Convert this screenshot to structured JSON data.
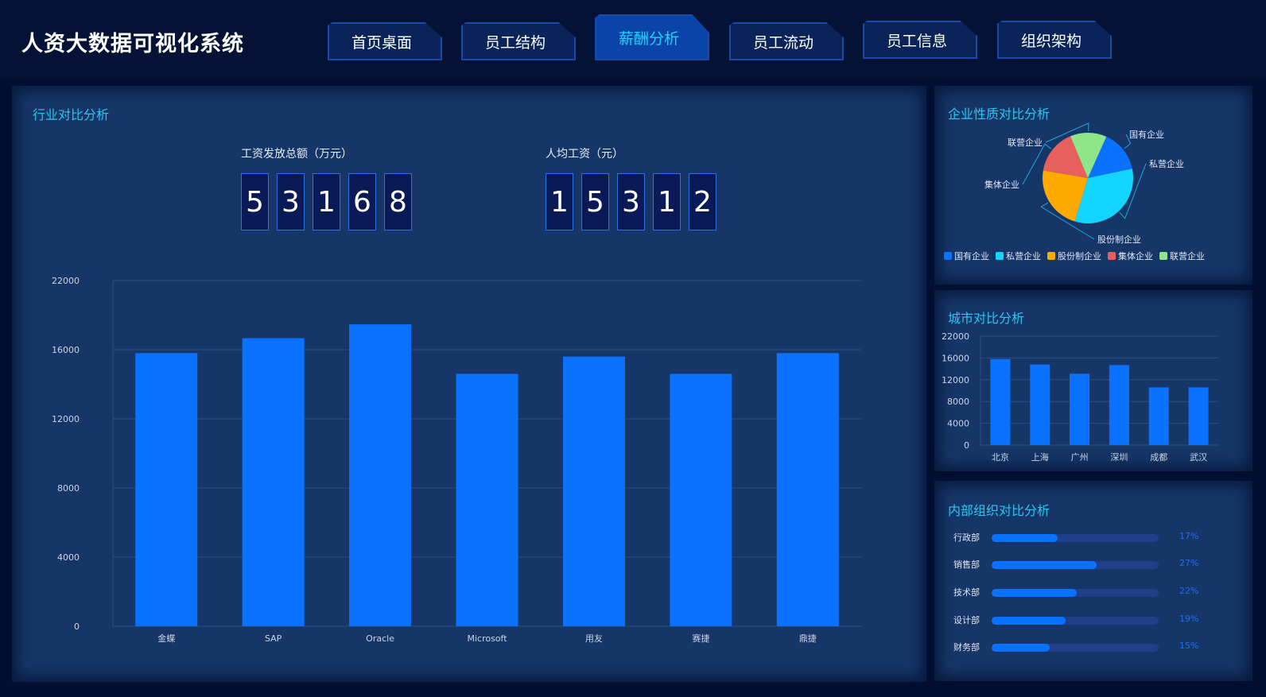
{
  "header": {
    "title": "人资大数据可视化系统",
    "tabs": [
      {
        "label": "首页桌面",
        "active": false
      },
      {
        "label": "员工结构",
        "active": false
      },
      {
        "label": "薪酬分析",
        "active": true
      },
      {
        "label": "员工流动",
        "active": false
      },
      {
        "label": "员工信息",
        "active": false
      },
      {
        "label": "组织架构",
        "active": false
      }
    ]
  },
  "industry": {
    "title": "行业对比分析",
    "kpis": [
      {
        "label": "工资发放总额（万元）",
        "digits": [
          "5",
          "3",
          "1",
          "6",
          "8"
        ]
      },
      {
        "label": "人均工资（元）",
        "digits": [
          "1",
          "5",
          "3",
          "1",
          "2"
        ]
      }
    ]
  },
  "enterprise": {
    "title": "企业性质对比分析"
  },
  "city": {
    "title": "城市对比分析"
  },
  "org": {
    "title": "内部组织对比分析",
    "items": [
      {
        "label": "行政部",
        "percent": 17,
        "display": "17%"
      },
      {
        "label": "销售部",
        "percent": 27,
        "display": "27%"
      },
      {
        "label": "技术部",
        "percent": 22,
        "display": "22%"
      },
      {
        "label": "设计部",
        "percent": 19,
        "display": "19%"
      },
      {
        "label": "财务部",
        "percent": 15,
        "display": "15%"
      }
    ]
  },
  "colors": {
    "accent": "#2bc6f1",
    "bar": "#0a72ff",
    "panel": "#163668",
    "background": "#030f30"
  },
  "chart_data": [
    {
      "type": "bar",
      "title": "行业对比分析",
      "categories": [
        "金蝶",
        "SAP",
        "Oracle",
        "Microsoft",
        "用友",
        "赛捷",
        "鼎捷"
      ],
      "values": [
        15800,
        17000,
        18200,
        14600,
        15600,
        14600,
        15800
      ],
      "yticks": [
        0,
        4000,
        8000,
        12000,
        16000,
        22000
      ],
      "ylim": [
        0,
        22000
      ],
      "grid": true,
      "color": "#0a72ff"
    },
    {
      "type": "pie",
      "title": "企业性质对比分析",
      "categories": [
        "国有企业",
        "私营企业",
        "股份制企业",
        "集体企业",
        "联营企业"
      ],
      "values": [
        15,
        33,
        23,
        16,
        13
      ],
      "colors": [
        "#0a72ff",
        "#12d6ff",
        "#ffaa00",
        "#e8605e",
        "#8ee58a"
      ],
      "legend": "bottom"
    },
    {
      "type": "bar",
      "title": "城市对比分析",
      "categories": [
        "北京",
        "上海",
        "广州",
        "深圳",
        "成都",
        "武汉"
      ],
      "values": [
        15800,
        14800,
        13100,
        14700,
        10600,
        10600
      ],
      "yticks": [
        0,
        4000,
        8000,
        12000,
        16000,
        22000
      ],
      "ylim": [
        0,
        22000
      ],
      "grid": true,
      "color": "#0a72ff"
    },
    {
      "type": "bar",
      "title": "内部组织对比分析",
      "orientation": "horizontal",
      "categories": [
        "行政部",
        "销售部",
        "技术部",
        "设计部",
        "财务部"
      ],
      "values": [
        17,
        27,
        22,
        19,
        15
      ],
      "unit": "%"
    }
  ]
}
